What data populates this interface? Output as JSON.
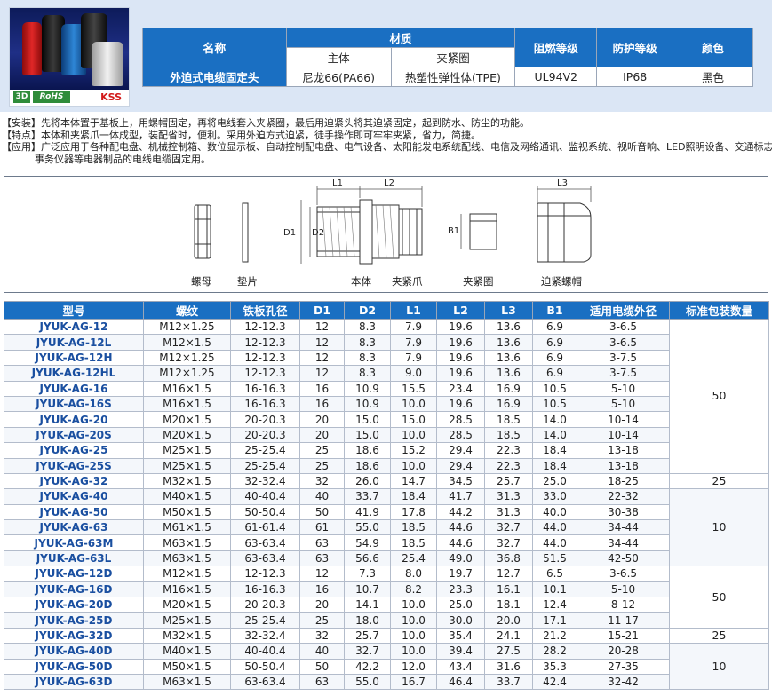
{
  "product": {
    "badges": {
      "three_d": "3D",
      "rohs": "RoHS",
      "brand": "KSS"
    },
    "spec_table": {
      "header_name": "名称",
      "header_material": "材质",
      "header_body": "主体",
      "header_clamp": "夹紧圈",
      "header_flame": "阻燃等级",
      "header_protection": "防护等级",
      "header_color": "颜色",
      "name": "外迫式电缆固定头",
      "body_material": "尼龙66(PA66)",
      "clamp_material": "热塑性弹性体(TPE)",
      "flame_rating": "UL94V2",
      "protection": "IP68",
      "color": "黑色"
    }
  },
  "description": {
    "install": "【安装】先将本体置于基板上，用螺帽固定，再将电线套入夹紧圈，最后用迫紧头将其迫紧固定，起到防水、防尘的功能。",
    "feature": "【特点】本体和夹紧爪一体成型，装配省时，便利。采用外迫方式迫紧，徒手操作即可牢牢夹紧，省力，简捷。",
    "application_1": "【应用】广泛应用于各种配电盘、机械控制箱、数位显示板、自动控制配电盘、电气设备、太阳能发电系统配线、电信及网络通讯、监视系统、视听音响、LED照明设备、交通标志、",
    "application_2": "事务仪器等电器制品的电线电缆固定用。"
  },
  "diagram": {
    "labels": {
      "nut": "螺母",
      "gasket": "垫片",
      "body": "本体",
      "claw": "夹紧爪",
      "clamp_ring": "夹紧圈",
      "cap_nut": "迫紧螺帽"
    },
    "dims": {
      "L1": "L1",
      "L2": "L2",
      "L3": "L3",
      "D1": "D1",
      "D2": "D2",
      "B1": "B1"
    }
  },
  "table": {
    "headers": [
      "型号",
      "螺纹",
      "铁板孔径",
      "D1",
      "D2",
      "L1",
      "L2",
      "L3",
      "B1",
      "适用电缆外径",
      "标准包装数量"
    ],
    "rows": [
      [
        "JYUK-AG-12",
        "M12×1.25",
        "12-12.3",
        "12",
        "8.3",
        "7.9",
        "19.6",
        "13.6",
        "6.9",
        "3-6.5"
      ],
      [
        "JYUK-AG-12L",
        "M12×1.5",
        "12-12.3",
        "12",
        "8.3",
        "7.9",
        "19.6",
        "13.6",
        "6.9",
        "3-6.5"
      ],
      [
        "JYUK-AG-12H",
        "M12×1.25",
        "12-12.3",
        "12",
        "8.3",
        "7.9",
        "19.6",
        "13.6",
        "6.9",
        "3-7.5"
      ],
      [
        "JYUK-AG-12HL",
        "M12×1.25",
        "12-12.3",
        "12",
        "8.3",
        "9.0",
        "19.6",
        "13.6",
        "6.9",
        "3-7.5"
      ],
      [
        "JYUK-AG-16",
        "M16×1.5",
        "16-16.3",
        "16",
        "10.9",
        "15.5",
        "23.4",
        "16.9",
        "10.5",
        "5-10"
      ],
      [
        "JYUK-AG-16S",
        "M16×1.5",
        "16-16.3",
        "16",
        "10.9",
        "10.0",
        "19.6",
        "16.9",
        "10.5",
        "5-10"
      ],
      [
        "JYUK-AG-20",
        "M20×1.5",
        "20-20.3",
        "20",
        "15.0",
        "15.0",
        "28.5",
        "18.5",
        "14.0",
        "10-14"
      ],
      [
        "JYUK-AG-20S",
        "M20×1.5",
        "20-20.3",
        "20",
        "15.0",
        "10.0",
        "28.5",
        "18.5",
        "14.0",
        "10-14"
      ],
      [
        "JYUK-AG-25",
        "M25×1.5",
        "25-25.4",
        "25",
        "18.6",
        "15.2",
        "29.4",
        "22.3",
        "18.4",
        "13-18"
      ],
      [
        "JYUK-AG-25S",
        "M25×1.5",
        "25-25.4",
        "25",
        "18.6",
        "10.0",
        "29.4",
        "22.3",
        "18.4",
        "13-18"
      ],
      [
        "JYUK-AG-32",
        "M32×1.5",
        "32-32.4",
        "32",
        "26.0",
        "14.7",
        "34.5",
        "25.7",
        "25.0",
        "18-25"
      ],
      [
        "JYUK-AG-40",
        "M40×1.5",
        "40-40.4",
        "40",
        "33.7",
        "18.4",
        "41.7",
        "31.3",
        "33.0",
        "22-32"
      ],
      [
        "JYUK-AG-50",
        "M50×1.5",
        "50-50.4",
        "50",
        "41.9",
        "17.8",
        "44.2",
        "31.3",
        "40.0",
        "30-38"
      ],
      [
        "JYUK-AG-63",
        "M61×1.5",
        "61-61.4",
        "61",
        "55.0",
        "18.5",
        "44.6",
        "32.7",
        "44.0",
        "34-44"
      ],
      [
        "JYUK-AG-63M",
        "M63×1.5",
        "63-63.4",
        "63",
        "54.9",
        "18.5",
        "44.6",
        "32.7",
        "44.0",
        "34-44"
      ],
      [
        "JYUK-AG-63L",
        "M63×1.5",
        "63-63.4",
        "63",
        "56.6",
        "25.4",
        "49.0",
        "36.8",
        "51.5",
        "42-50"
      ],
      [
        "JYUK-AG-12D",
        "M12×1.5",
        "12-12.3",
        "12",
        "7.3",
        "8.0",
        "19.7",
        "12.7",
        "6.5",
        "3-6.5"
      ],
      [
        "JYUK-AG-16D",
        "M16×1.5",
        "16-16.3",
        "16",
        "10.7",
        "8.2",
        "23.3",
        "16.1",
        "10.1",
        "5-10"
      ],
      [
        "JYUK-AG-20D",
        "M20×1.5",
        "20-20.3",
        "20",
        "14.1",
        "10.0",
        "25.0",
        "18.1",
        "12.4",
        "8-12"
      ],
      [
        "JYUK-AG-25D",
        "M25×1.5",
        "25-25.4",
        "25",
        "18.0",
        "10.0",
        "30.0",
        "20.0",
        "17.1",
        "11-17"
      ],
      [
        "JYUK-AG-32D",
        "M32×1.5",
        "32-32.4",
        "32",
        "25.7",
        "10.0",
        "35.4",
        "24.1",
        "21.2",
        "15-21"
      ],
      [
        "JYUK-AG-40D",
        "M40×1.5",
        "40-40.4",
        "40",
        "32.7",
        "10.0",
        "39.4",
        "27.5",
        "28.2",
        "20-28"
      ],
      [
        "JYUK-AG-50D",
        "M50×1.5",
        "50-50.4",
        "50",
        "42.2",
        "12.0",
        "43.4",
        "31.6",
        "35.3",
        "27-35"
      ],
      [
        "JYUK-AG-63D",
        "M63×1.5",
        "63-63.4",
        "63",
        "55.0",
        "16.7",
        "46.4",
        "33.7",
        "42.4",
        "32-42"
      ]
    ],
    "pack_groups": [
      {
        "rows": 10,
        "value": "50"
      },
      {
        "rows": 1,
        "value": "25"
      },
      {
        "rows": 5,
        "value": "10"
      },
      {
        "rows": 4,
        "value": "50"
      },
      {
        "rows": 1,
        "value": "25"
      },
      {
        "rows": 3,
        "value": "10"
      }
    ]
  },
  "colors": {
    "accent": "#1a6fc2",
    "band": "#dbe6f5",
    "model_text": "#1a4fa0"
  }
}
